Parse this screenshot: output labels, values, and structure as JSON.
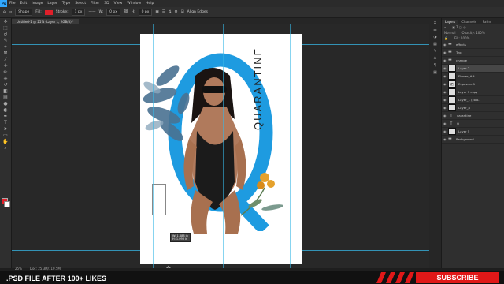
{
  "app": {
    "logo": "Ps",
    "menu": [
      "File",
      "Edit",
      "Image",
      "Layer",
      "Type",
      "Select",
      "Filter",
      "3D",
      "View",
      "Window",
      "Help"
    ]
  },
  "options_bar": {
    "shape_mode": "Shape",
    "fill_label": "Fill:",
    "stroke_label": "Stroke:",
    "stroke_size": "1 px",
    "w_label": "W:",
    "w_value": "0 px",
    "h_label": "H:",
    "h_value": "0 px",
    "align_edges": "Align Edges"
  },
  "document_tab": {
    "title": "Untitled-1 @ 25% (Layer 1, RGB/8) *"
  },
  "canvas": {
    "vertical_text": "QUARANTINE",
    "tooltip_w": "W: 1.688 in",
    "tooltip_h": "H: 1.093 in"
  },
  "status": {
    "zoom": "25%",
    "doc": "Doc: 25.3M/110.5M"
  },
  "layers_panel": {
    "tabs": [
      "Layers",
      "Channels",
      "Paths"
    ],
    "blend_mode": "Normal",
    "opacity": "Opacity: 100%",
    "fill": "Fill: 100%",
    "layers": [
      {
        "name": "effects",
        "type": "folder",
        "selected": false
      },
      {
        "name": "Text",
        "type": "folder",
        "selected": false
      },
      {
        "name": "change",
        "type": "folder",
        "selected": false
      },
      {
        "name": "Layer 2",
        "type": "layer",
        "selected": true
      },
      {
        "name": "Flower_##",
        "type": "layer",
        "selected": false
      },
      {
        "name": "Exposure 1",
        "type": "adjust",
        "selected": false
      },
      {
        "name": "Layer 1 copy",
        "type": "layer",
        "selected": false
      },
      {
        "name": "Layer_1 (colo..",
        "type": "layer",
        "selected": false
      },
      {
        "name": "Layer_8",
        "type": "layer",
        "selected": false
      },
      {
        "name": "uarantine",
        "type": "text",
        "selected": false
      },
      {
        "name": "Q",
        "type": "text",
        "selected": false
      },
      {
        "name": "Layer 5",
        "type": "layer",
        "selected": false
      },
      {
        "name": "Background",
        "type": "folder",
        "selected": false
      }
    ]
  },
  "banner": {
    "left_text": ".PSD FILE AFTER 100+ LIKES",
    "button": "SUBSCRIBE",
    "accent": "#e01818"
  },
  "colors": {
    "guide": "#37b7e6",
    "q_blue": "#1e9be0",
    "foreground": "#e0202a"
  }
}
